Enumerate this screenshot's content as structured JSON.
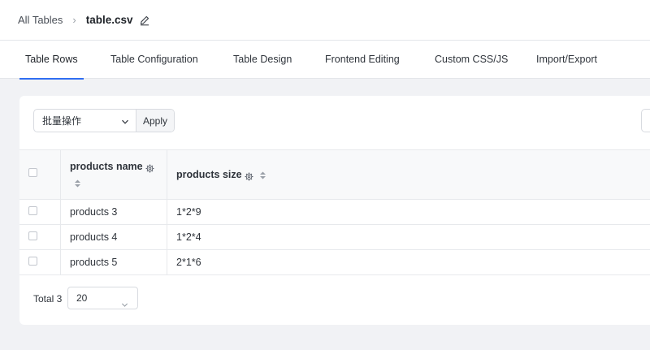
{
  "breadcrumb": {
    "root": "All Tables",
    "separator": "›",
    "current": "table.csv"
  },
  "icons": {
    "edit": "pencil-icon",
    "settings": "gear-icon",
    "sort": "sort-icon",
    "dropdown": "chevron-down-icon"
  },
  "tabs": [
    {
      "label": "Table Rows",
      "active": true
    },
    {
      "label": "Table Configuration",
      "active": false
    },
    {
      "label": "Table Design",
      "active": false
    },
    {
      "label": "Frontend Editing",
      "active": false
    },
    {
      "label": "Custom CSS/JS",
      "active": false
    },
    {
      "label": "Import/Export",
      "active": false
    }
  ],
  "toolbar": {
    "bulk_action_value": "批量操作",
    "apply_label": "Apply"
  },
  "table": {
    "columns": [
      "products name",
      "products size"
    ],
    "rows": [
      [
        "products 3",
        "1*2*9"
      ],
      [
        "products 4",
        "1*2*4"
      ],
      [
        "products 5",
        "2*1*6"
      ]
    ]
  },
  "pagination": {
    "total_label": "Total 3",
    "page_size": "20"
  },
  "colors": {
    "accent": "#2f6ef2",
    "background": "#f1f2f5"
  }
}
